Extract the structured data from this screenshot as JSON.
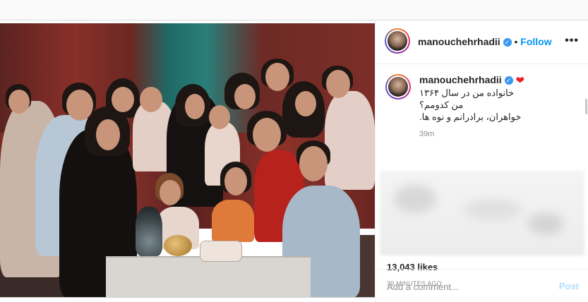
{
  "post": {
    "author": "manouchehrhadii",
    "verified_icon": "verified-badge-icon",
    "follow_label": "Follow",
    "separator": "•",
    "more_label": "•••"
  },
  "caption": {
    "username": "manouchehrhadii",
    "heart": "❤",
    "lines": [
      "خانواده من در سال ۱۳۶۴",
      "من کدومم؟",
      "خواهران، برادرانم و نوه ها."
    ],
    "time": "39m"
  },
  "stats": {
    "likes": "13,043 likes",
    "posted": "39 MINUTES AGO"
  },
  "comment": {
    "placeholder": "Add a comment...",
    "post_label": "Post"
  },
  "colors": {
    "accent": "#0095f6",
    "verified": "#3897f0",
    "heart": "#ed1c24",
    "post_disabled": "#b2dffc"
  }
}
